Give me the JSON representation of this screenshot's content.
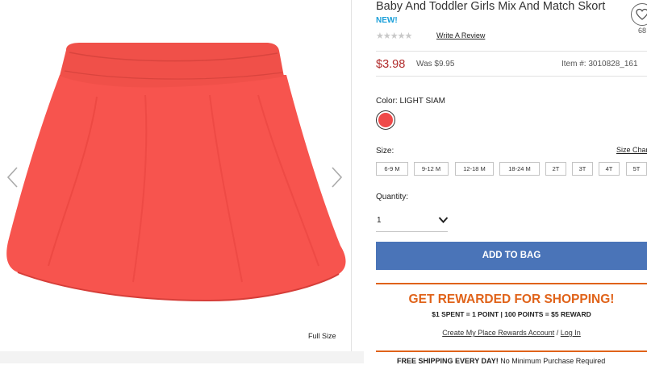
{
  "product": {
    "title": "Baby And Toddler Girls Mix And Match Skort",
    "badge": "NEW!",
    "stars": "★★★★★",
    "write_review": "Write A Review",
    "favorites_count": "68",
    "price": "$3.98",
    "was_price": "Was $9.95",
    "item_number": "Item #: 3010828_161"
  },
  "gallery": {
    "full_size_label": "Full Size",
    "image_color": "#f9504b"
  },
  "color": {
    "label": "Color: LIGHT SIAM",
    "swatch_hex": "#ef4a4a"
  },
  "size": {
    "label": "Size:",
    "chart_link": "Size Chart",
    "options": [
      "6-9 M",
      "9-12 M",
      "12-18 M",
      "18-24 M",
      "2T",
      "3T",
      "4T",
      "5T"
    ]
  },
  "quantity": {
    "label": "Quantity:",
    "value": "1"
  },
  "cta": {
    "add_to_bag": "ADD TO BAG",
    "color": "#4a74b8"
  },
  "rewards": {
    "title": "GET REWARDED FOR SHOPPING!",
    "subtitle": "$1 SPENT = 1 POINT | 100 POINTS = $5 REWARD",
    "create_link": "Create My Place Rewards Account",
    "separator": " / ",
    "login_link": "Log In",
    "accent": "#e0631a"
  },
  "shipping": {
    "bold": "FREE SHIPPING EVERY DAY!",
    "text": " No Minimum Purchase Required"
  }
}
